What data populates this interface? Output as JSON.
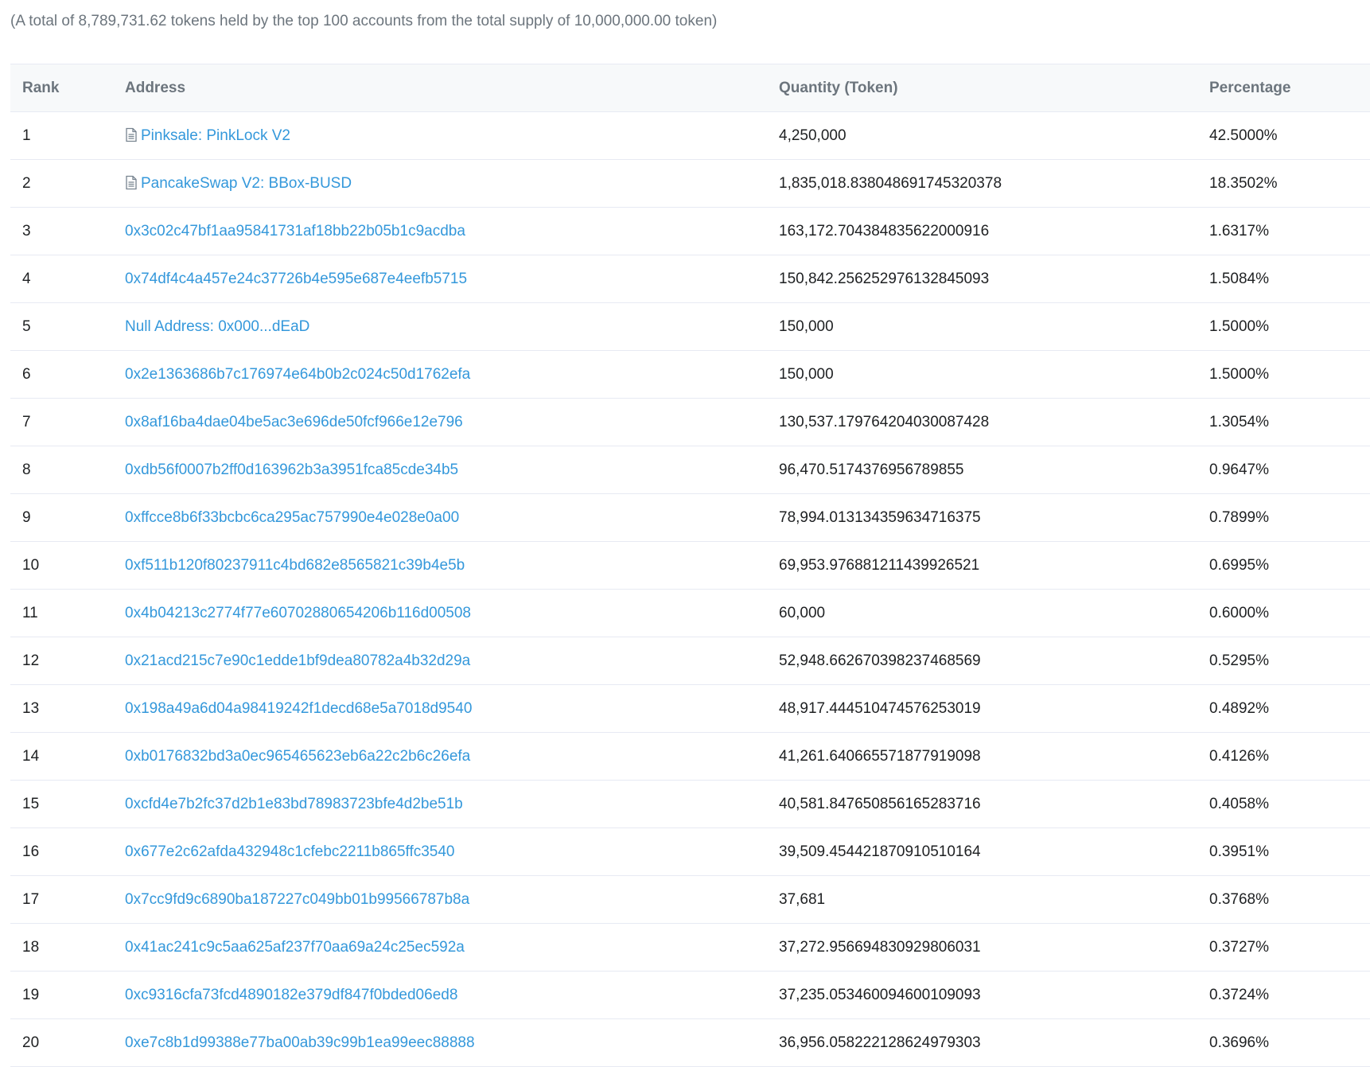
{
  "summary": "(A total of 8,789,731.62 tokens held by the top 100 accounts from the total supply of 10,000,000.00 token)",
  "columns": {
    "rank": "Rank",
    "address": "Address",
    "quantity": "Quantity (Token)",
    "percentage": "Percentage"
  },
  "colors": {
    "link": "#3498db",
    "muted": "#6c757d",
    "text": "#1e2022",
    "border": "#e7eaf3"
  },
  "rows": [
    {
      "rank": "1",
      "address": "Pinksale: PinkLock V2",
      "contract": true,
      "quantity": "4,250,000",
      "percentage": "42.5000%"
    },
    {
      "rank": "2",
      "address": "PancakeSwap V2: BBox-BUSD",
      "contract": true,
      "quantity": "1,835,018.838048691745320378",
      "percentage": "18.3502%"
    },
    {
      "rank": "3",
      "address": "0x3c02c47bf1aa95841731af18bb22b05b1c9acdba",
      "contract": false,
      "quantity": "163,172.704384835622000916",
      "percentage": "1.6317%"
    },
    {
      "rank": "4",
      "address": "0x74df4c4a457e24c37726b4e595e687e4eefb5715",
      "contract": false,
      "quantity": "150,842.256252976132845093",
      "percentage": "1.5084%"
    },
    {
      "rank": "5",
      "address": "Null Address: 0x000...dEaD",
      "contract": false,
      "quantity": "150,000",
      "percentage": "1.5000%"
    },
    {
      "rank": "6",
      "address": "0x2e1363686b7c176974e64b0b2c024c50d1762efa",
      "contract": false,
      "quantity": "150,000",
      "percentage": "1.5000%"
    },
    {
      "rank": "7",
      "address": "0x8af16ba4dae04be5ac3e696de50fcf966e12e796",
      "contract": false,
      "quantity": "130,537.179764204030087428",
      "percentage": "1.3054%"
    },
    {
      "rank": "8",
      "address": "0xdb56f0007b2ff0d163962b3a3951fca85cde34b5",
      "contract": false,
      "quantity": "96,470.5174376956789855",
      "percentage": "0.9647%"
    },
    {
      "rank": "9",
      "address": "0xffcce8b6f33bcbc6ca295ac757990e4e028e0a00",
      "contract": false,
      "quantity": "78,994.013134359634716375",
      "percentage": "0.7899%"
    },
    {
      "rank": "10",
      "address": "0xf511b120f80237911c4bd682e8565821c39b4e5b",
      "contract": false,
      "quantity": "69,953.976881211439926521",
      "percentage": "0.6995%"
    },
    {
      "rank": "11",
      "address": "0x4b04213c2774f77e60702880654206b116d00508",
      "contract": false,
      "quantity": "60,000",
      "percentage": "0.6000%"
    },
    {
      "rank": "12",
      "address": "0x21acd215c7e90c1edde1bf9dea80782a4b32d29a",
      "contract": false,
      "quantity": "52,948.662670398237468569",
      "percentage": "0.5295%"
    },
    {
      "rank": "13",
      "address": "0x198a49a6d04a98419242f1decd68e5a7018d9540",
      "contract": false,
      "quantity": "48,917.444510474576253019",
      "percentage": "0.4892%"
    },
    {
      "rank": "14",
      "address": "0xb0176832bd3a0ec965465623eb6a22c2b6c26efa",
      "contract": false,
      "quantity": "41,261.640665571877919098",
      "percentage": "0.4126%"
    },
    {
      "rank": "15",
      "address": "0xcfd4e7b2fc37d2b1e83bd78983723bfe4d2be51b",
      "contract": false,
      "quantity": "40,581.847650856165283716",
      "percentage": "0.4058%"
    },
    {
      "rank": "16",
      "address": "0x677e2c62afda432948c1cfebc2211b865ffc3540",
      "contract": false,
      "quantity": "39,509.454421870910510164",
      "percentage": "0.3951%"
    },
    {
      "rank": "17",
      "address": "0x7cc9fd9c6890ba187227c049bb01b99566787b8a",
      "contract": false,
      "quantity": "37,681",
      "percentage": "0.3768%"
    },
    {
      "rank": "18",
      "address": "0x41ac241c9c5aa625af237f70aa69a24c25ec592a",
      "contract": false,
      "quantity": "37,272.956694830929806031",
      "percentage": "0.3727%"
    },
    {
      "rank": "19",
      "address": "0xc9316cfa73fcd4890182e379df847f0bded06ed8",
      "contract": false,
      "quantity": "37,235.053460094600109093",
      "percentage": "0.3724%"
    },
    {
      "rank": "20",
      "address": "0xe7c8b1d99388e77ba00ab39c99b1ea99eec88888",
      "contract": false,
      "quantity": "36,956.058222128624979303",
      "percentage": "0.3696%"
    }
  ]
}
